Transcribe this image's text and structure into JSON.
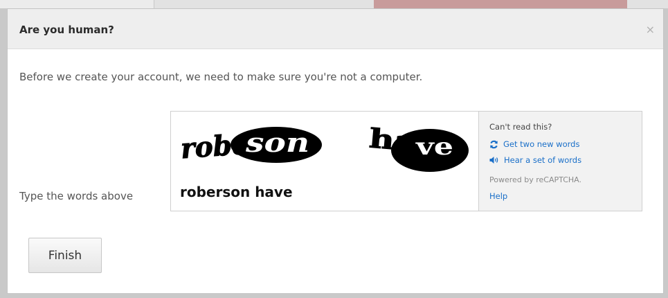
{
  "dialog": {
    "title": "Are you human?",
    "close_icon": "close-icon",
    "intro": "Before we create your account, we need to make sure you're not a computer.",
    "type_label": "Type the words above"
  },
  "captcha": {
    "words": [
      "roberson",
      "have"
    ],
    "input_value": "roberson have",
    "cant_read": "Can't read this?",
    "reload_label": "Get two new words",
    "reload_icon": "refresh-icon",
    "audio_label": "Hear a set of words",
    "audio_icon": "speaker-icon",
    "powered_by": "Powered by reCAPTCHA.",
    "help_label": "Help"
  },
  "actions": {
    "finish_label": "Finish"
  },
  "colors": {
    "link": "#1a6fc8",
    "header_bg": "#eeeeee",
    "side_bg": "#f2f2f2"
  }
}
